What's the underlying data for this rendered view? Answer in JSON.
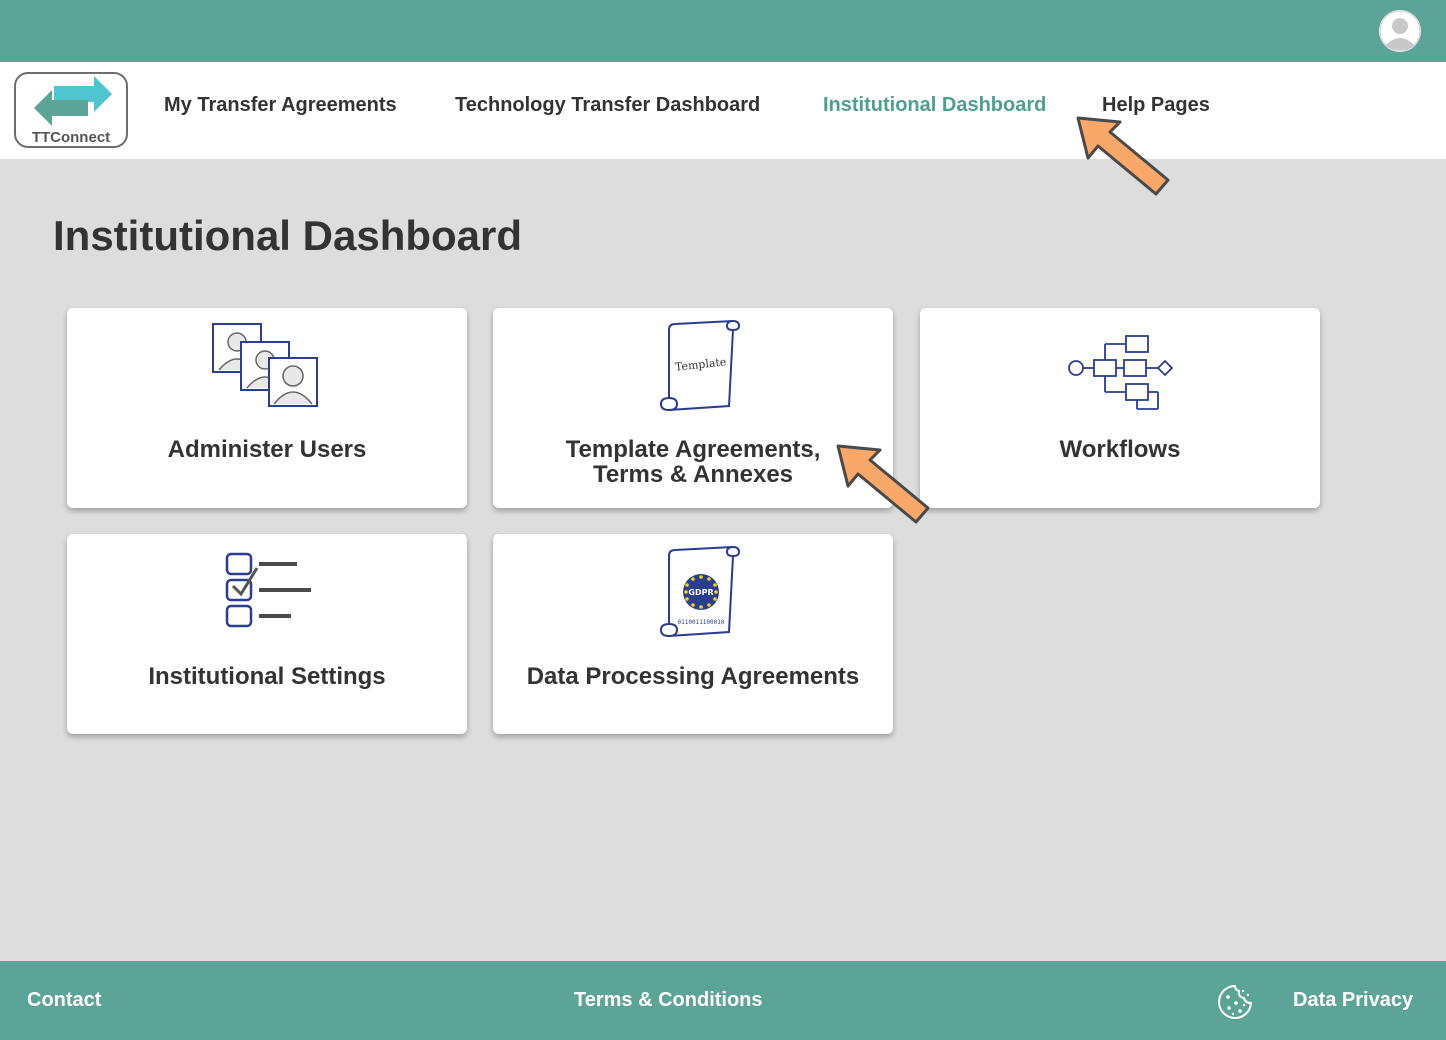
{
  "header": {
    "avatar_icon": "user-avatar-icon"
  },
  "nav": {
    "logo_text": "TTConnect",
    "links": [
      {
        "label": "My Transfer Agreements"
      },
      {
        "label": "Technology Transfer Dashboard"
      },
      {
        "label": "Institutional Dashboard",
        "active": true
      },
      {
        "label": "Help Pages"
      }
    ]
  },
  "page": {
    "title": "Institutional Dashboard"
  },
  "cards": [
    {
      "label": "Administer Users",
      "icon": "users-icon"
    },
    {
      "label_line1": "Template Agreements,",
      "label_line2": "Terms & Annexes",
      "icon": "template-scroll-icon",
      "icon_text": "Template"
    },
    {
      "label": "Workflows",
      "icon": "workflow-diagram-icon"
    },
    {
      "label": "Institutional Settings",
      "icon": "checklist-icon"
    },
    {
      "label": "Data Processing Agreements",
      "icon": "gdpr-scroll-icon",
      "icon_text": "GDPR",
      "icon_binary": "0110011100010"
    }
  ],
  "footer": {
    "contact": "Contact",
    "terms": "Terms & Conditions",
    "privacy": "Data Privacy",
    "cookie_icon": "cookie-icon"
  },
  "colors": {
    "brand": "#5ca498",
    "active_link": "#4e9e92",
    "icon_blue": "#2a3d8f",
    "callout_orange": "#f9a86a",
    "background": "#dddddd"
  }
}
